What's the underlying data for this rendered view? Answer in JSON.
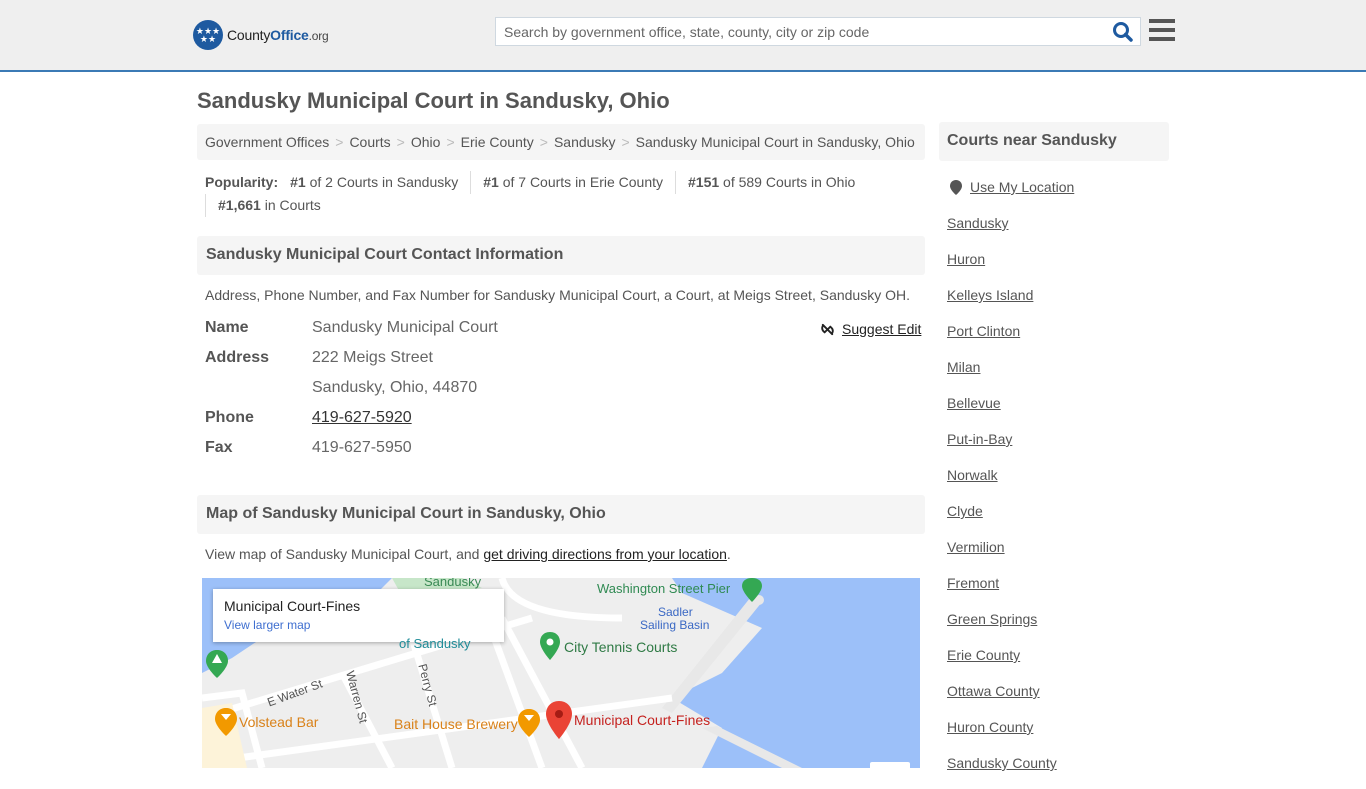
{
  "header": {
    "logo": {
      "part1": "County",
      "part2": "Office",
      "part3": ".org"
    },
    "search": {
      "placeholder": "Search by government office, state, county, city or zip code",
      "value": ""
    },
    "icons": {
      "search": "search-icon",
      "menu": "hamburger-menu-icon"
    }
  },
  "page": {
    "title": "Sandusky Municipal Court in Sandusky, Ohio",
    "breadcrumb": [
      "Government Offices",
      "Courts",
      "Ohio",
      "Erie County",
      "Sandusky",
      "Sandusky Municipal Court in Sandusky, Ohio"
    ],
    "popularity": {
      "label": "Popularity:",
      "items": [
        {
          "rank": "#1",
          "text": "of 2 Courts in Sandusky"
        },
        {
          "rank": "#1",
          "text": "of 7 Courts in Erie County"
        },
        {
          "rank": "#151",
          "text": "of 589 Courts in Ohio"
        },
        {
          "rank": "#1,661",
          "text": "in Courts"
        }
      ]
    }
  },
  "contact": {
    "heading": "Sandusky Municipal Court Contact Information",
    "description": "Address, Phone Number, and Fax Number for Sandusky Municipal Court, a Court, at Meigs Street, Sandusky OH.",
    "suggest_edit": "Suggest Edit",
    "rows": {
      "name_label": "Name",
      "name_value": "Sandusky Municipal Court",
      "address_label": "Address",
      "address_line1": "222 Meigs Street",
      "address_line2": "Sandusky, Ohio, 44870",
      "phone_label": "Phone",
      "phone_value": "419-627-5920",
      "fax_label": "Fax",
      "fax_value": "419-627-5950"
    }
  },
  "map_section": {
    "heading": "Map of Sandusky Municipal Court in Sandusky, Ohio",
    "desc_prefix": "View map of Sandusky Municipal Court, and ",
    "desc_link": "get driving directions from your location",
    "desc_suffix": ".",
    "card_title": "Municipal Court-Fines",
    "card_link": "View larger map",
    "labels": {
      "sandusky_top": "Sandusky",
      "of_sandusky": "of Sandusky",
      "washington_pier": "Washington Street Pier",
      "sadler1": "Sadler",
      "sadler2": "Sailing Basin",
      "tennis": "City Tennis Courts",
      "water_st": "E Water St",
      "warren_st": "Warren St",
      "perry_st": "Perry St",
      "volstead": "Volstead Bar",
      "bait_house": "Bait House Brewery",
      "court_pin": "Municipal Court-Fines"
    }
  },
  "sidebar": {
    "heading": "Courts near Sandusky",
    "use_location": "Use My Location",
    "items": [
      "Sandusky",
      "Huron",
      "Kelleys Island",
      "Port Clinton",
      "Milan",
      "Bellevue",
      "Put-in-Bay",
      "Norwalk",
      "Clyde",
      "Vermilion",
      "Fremont",
      "Green Springs",
      "Erie County",
      "Ottawa County",
      "Huron County",
      "Sandusky County"
    ]
  }
}
